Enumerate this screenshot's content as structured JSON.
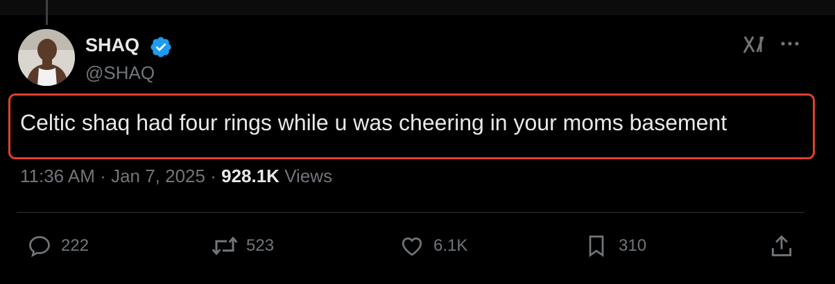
{
  "author": {
    "display_name": "SHAQ",
    "handle": "@SHAQ",
    "verified": true,
    "verified_color": "#1d9bf0"
  },
  "tweet": {
    "text": "Celtic shaq had four rings while u was cheering in your moms basement",
    "time": "11:36 AM",
    "date": "Jan 7, 2025",
    "separator": "·",
    "views_count": "928.1K",
    "views_label": "Views"
  },
  "actions": {
    "replies": "222",
    "reposts": "523",
    "likes": "6.1K",
    "bookmarks": "310"
  },
  "icons": [
    "grok-icon",
    "more-icon",
    "reply-icon",
    "repost-icon",
    "like-icon",
    "bookmark-icon",
    "share-icon"
  ],
  "colors": {
    "background": "#000000",
    "text_primary": "#e7e9ea",
    "text_secondary": "#71767b",
    "highlight_border": "#e0402f"
  }
}
